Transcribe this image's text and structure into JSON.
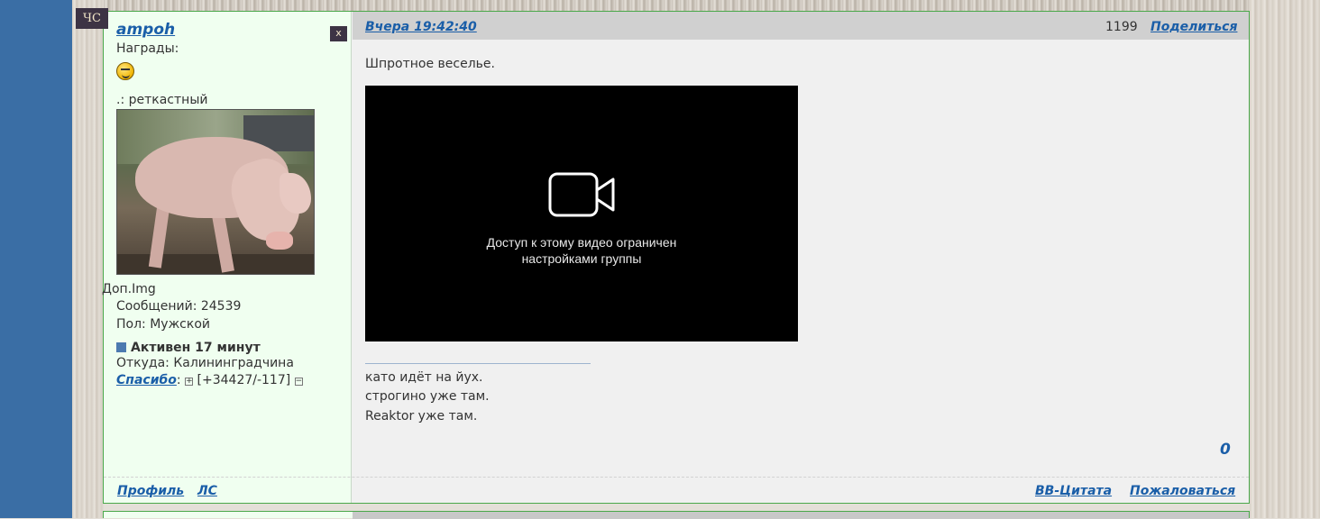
{
  "blacklist_label": "ЧС",
  "user": {
    "close_label": "x",
    "name": "ampoh",
    "awards_label": "Награды:",
    "award_icon": "smiley-icon",
    "title": ".: реткастный",
    "extra_img_label": "Доп.Img",
    "messages": "Сообщений: 24539",
    "gender": "Пол: Мужской",
    "active": "Активен 17 минут",
    "from": "Откуда: Калининградчина",
    "thanks_label": "Спасибо",
    "thanks_colon": ":",
    "thanks_plus": "+",
    "thanks_value": "[+34427/-117]",
    "thanks_minus": "−"
  },
  "post": {
    "date": "Вчера 19:42:40",
    "number": "1199",
    "share_label": "Поделиться",
    "text": "Шпротное веселье.",
    "video": {
      "icon": "video-camera-icon",
      "message_line1": "Доступ к этому видео ограничен",
      "message_line2": "настройками группы"
    },
    "signature": [
      "като идёт на йух.",
      "строгино уже там.",
      "Reaktor уже там."
    ],
    "rating": "0"
  },
  "footer": {
    "profile_label": "Профиль",
    "pm_label": "ЛС",
    "quote_label": "BB-Цитата",
    "report_label": "Пожаловаться"
  }
}
